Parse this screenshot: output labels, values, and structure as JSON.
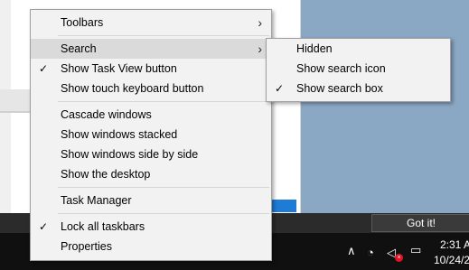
{
  "context_menu": {
    "items": [
      {
        "label": "Toolbars",
        "submenu": true
      },
      {
        "label": "Search",
        "submenu": true,
        "highlighted": true
      },
      {
        "label": "Show Task View button",
        "checked": true
      },
      {
        "label": "Show touch keyboard button"
      },
      {
        "label": "Cascade windows"
      },
      {
        "label": "Show windows stacked"
      },
      {
        "label": "Show windows side by side"
      },
      {
        "label": "Show the desktop"
      },
      {
        "label": "Task Manager"
      },
      {
        "label": "Lock all taskbars",
        "checked": true
      },
      {
        "label": "Properties"
      }
    ]
  },
  "search_submenu": {
    "items": [
      {
        "label": "Hidden"
      },
      {
        "label": "Show search icon"
      },
      {
        "label": "Show search box",
        "checked": true
      }
    ]
  },
  "taskbar": {
    "got_it_label": "Got it!",
    "time": "2:31 A",
    "date": "10/24/2"
  },
  "glyphs": {
    "check": "✓",
    "arrow": "›",
    "up_chevron": "∧",
    "wifi": "◔",
    "volume": "◁",
    "mute_x": "×",
    "notify": "▭"
  },
  "colors": {
    "menu_bg": "#f2f2f2",
    "menu_highlight": "#dadada",
    "taskbar": "#101010",
    "desktop": "#8aa7c4",
    "mute_badge": "#e81123"
  }
}
